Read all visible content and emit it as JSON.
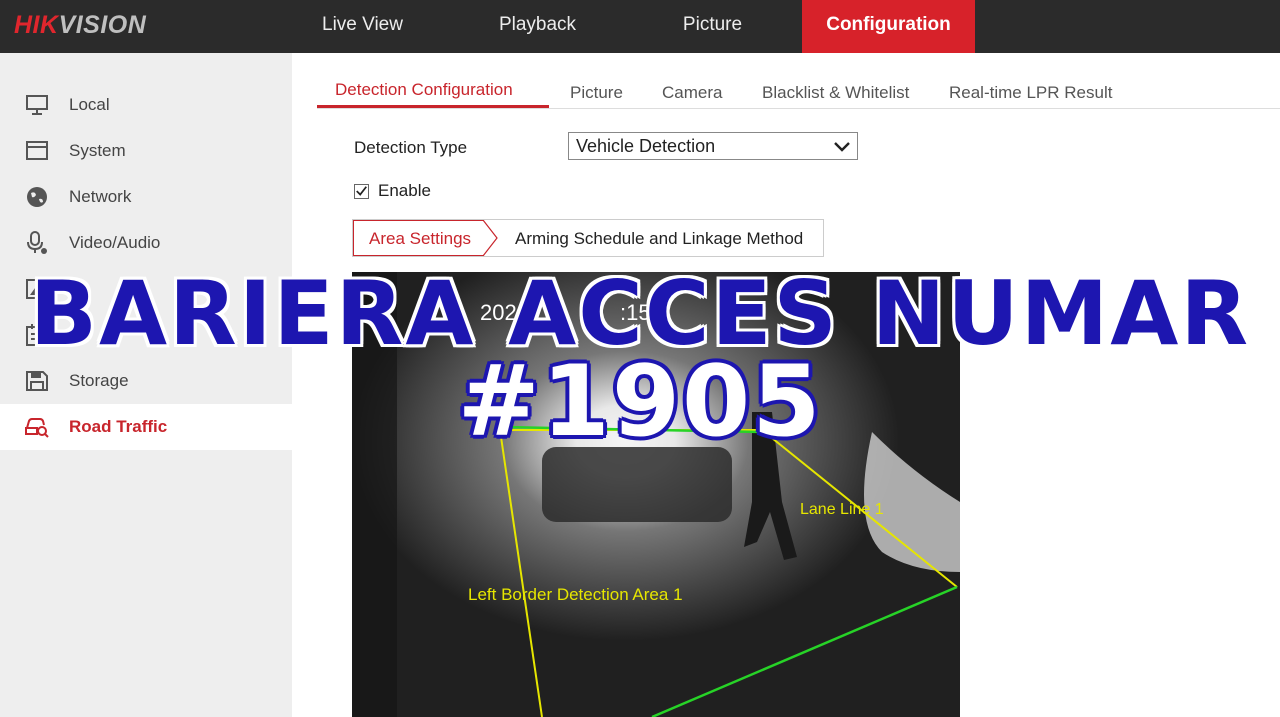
{
  "logo": {
    "part1": "HIK",
    "part2": "VISION"
  },
  "top_nav": [
    {
      "label": "Live View"
    },
    {
      "label": "Playback"
    },
    {
      "label": "Picture"
    },
    {
      "label": "Configuration",
      "active": true
    }
  ],
  "sidebar": {
    "items": [
      {
        "label": "Local",
        "icon": "monitor-icon"
      },
      {
        "label": "System",
        "icon": "window-icon"
      },
      {
        "label": "Network",
        "icon": "globe-icon"
      },
      {
        "label": "Video/Audio",
        "icon": "microphone-icon"
      },
      {
        "label": "",
        "icon": "image-icon"
      },
      {
        "label": "",
        "icon": "calendar-icon"
      },
      {
        "label": "Storage",
        "icon": "save-icon"
      },
      {
        "label": "Road Traffic",
        "icon": "car-search-icon",
        "active": true
      }
    ]
  },
  "sub_tabs": [
    {
      "label": "Detection Configuration",
      "active": true
    },
    {
      "label": "Picture"
    },
    {
      "label": "Camera"
    },
    {
      "label": "Blacklist & Whitelist"
    },
    {
      "label": "Real-time LPR Result"
    }
  ],
  "form": {
    "detection_type_label": "Detection Type",
    "detection_type_value": "Vehicle Detection",
    "enable_label": "Enable",
    "enable_checked": true
  },
  "steps": {
    "area_settings": "Area Settings",
    "arming": "Arming Schedule and Linkage Method"
  },
  "camera": {
    "osd_date": "2026",
    "osd_time": ":15",
    "lane_label": "Lane Line 1",
    "area_label": "Left Border  Detection Area 1"
  },
  "overlay": {
    "line1": "BARIERA ACCES NUMAR",
    "line2": "#1905"
  },
  "colors": {
    "brand_red": "#d7222a",
    "topbar_bg": "#2b2b2b",
    "overlay_blue": "#1d16b0"
  }
}
